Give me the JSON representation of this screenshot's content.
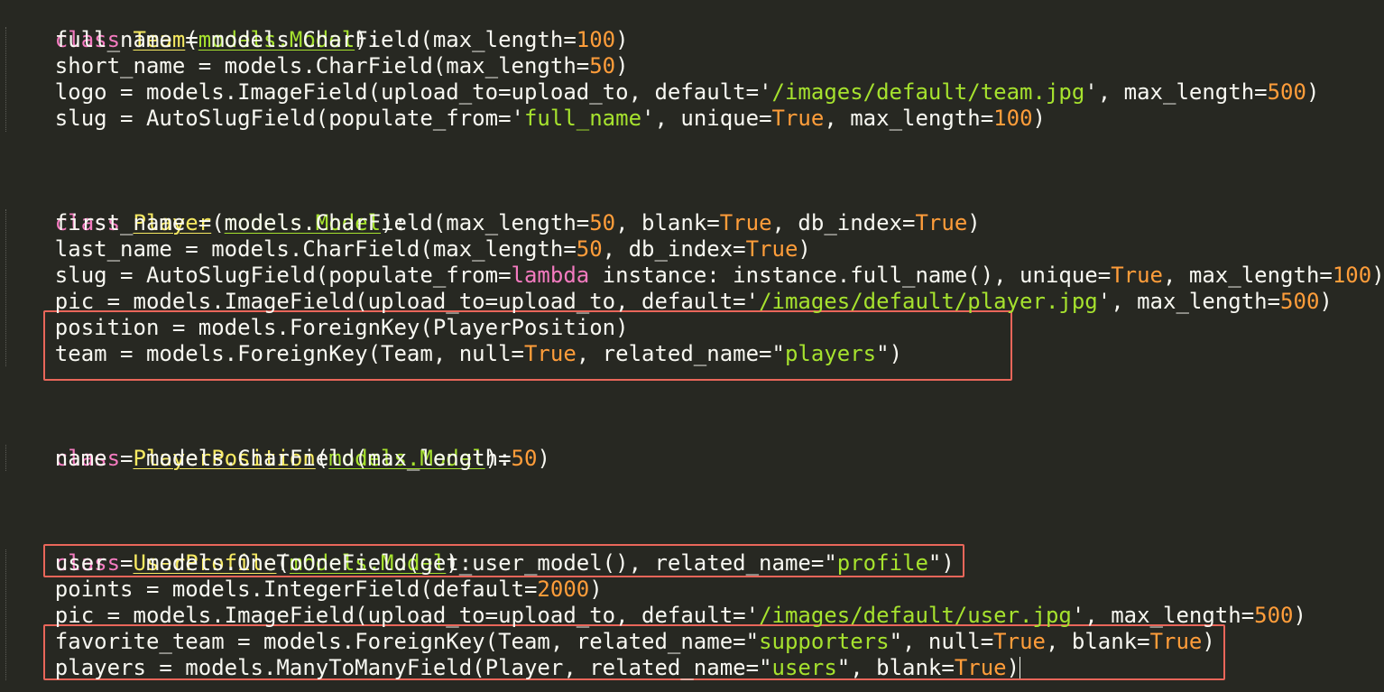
{
  "code": {
    "team_class": {
      "keyword": "class",
      "name": "Team",
      "base": "models.Model",
      "fields": {
        "full_name_pre": "full_name = models.CharField(max_length=",
        "full_name_num": "100",
        "short_name_pre": "short_name = models.CharField(max_length=",
        "short_name_num": "50",
        "logo_pre": "logo = models.ImageField(upload_to=upload_to, default=",
        "logo_str": "/images/default/team.jpg",
        "logo_mid": ", max_length=",
        "logo_num": "500",
        "slug_pre": "slug = AutoSlugField(populate_from=",
        "slug_str": "full_name",
        "slug_mid": ", unique=",
        "slug_bool": "True",
        "slug_mid2": ", max_length=",
        "slug_num": "100"
      }
    },
    "player_class": {
      "keyword": "class",
      "name": "Player",
      "base": "models.Model",
      "fields": {
        "first_pre": "first_name = models.CharField(max_length=",
        "first_num": "50",
        "first_mid": ", blank=",
        "first_bool": "True",
        "first_mid2": ", db_index=",
        "first_bool2": "True",
        "last_pre": "last_name = models.CharField(max_length=",
        "last_num": "50",
        "last_mid": ", db_index=",
        "last_bool": "True",
        "slug_pre": "slug = AutoSlugField(populate_from=",
        "slug_lambda": "lambda",
        "slug_mid": " instance: instance.full_name(), unique=",
        "slug_bool": "True",
        "slug_mid2": ", max_length=",
        "slug_num": "100",
        "pic_pre": "pic = models.ImageField(upload_to=upload_to, default=",
        "pic_str": "/images/default/player.jpg",
        "pic_mid": ", max_length=",
        "pic_num": "500",
        "position_line": "position = models.ForeignKey(PlayerPosition)",
        "team_pre": "team = models.ForeignKey(Team, null=",
        "team_bool": "True",
        "team_mid": ", related_name=",
        "team_str": "players"
      }
    },
    "position_class": {
      "keyword": "class",
      "name": "PlayerPosition",
      "base": "models.Model",
      "fields": {
        "name_pre": "name = models.CharField(max_length=",
        "name_num": "50"
      }
    },
    "profile_class": {
      "keyword": "class",
      "name": "UserProfile",
      "base": "models.Model",
      "fields": {
        "user_pre": "user = models.OneToOneField(get_user_model(), related_name=",
        "user_str": "profile",
        "points_pre": "points = models.IntegerField(default=",
        "points_num": "2000",
        "pic_pre": "pic = models.ImageField(upload_to=upload_to, default=",
        "pic_str": "/images/default/user.jpg",
        "pic_mid": ", max_length=",
        "pic_num": "500",
        "fav_pre": "favorite_team = models.ForeignKey(Team, related_name=",
        "fav_str": "supporters",
        "fav_mid": ", null=",
        "fav_bool": "True",
        "fav_mid2": ", blank=",
        "fav_bool2": "True",
        "players_pre": "players = models.ManyToManyField(Player, related_name=",
        "players_str": "users",
        "players_mid": ", blank=",
        "players_bool": "True"
      }
    }
  },
  "colors": {
    "background": "#272822",
    "keyword": "#f47bc0",
    "class_name": "#f7ea62",
    "base_class": "#a6e22e",
    "number": "#ff9d3a",
    "string": "#a6e22e",
    "highlight_box": "#e9665a"
  }
}
